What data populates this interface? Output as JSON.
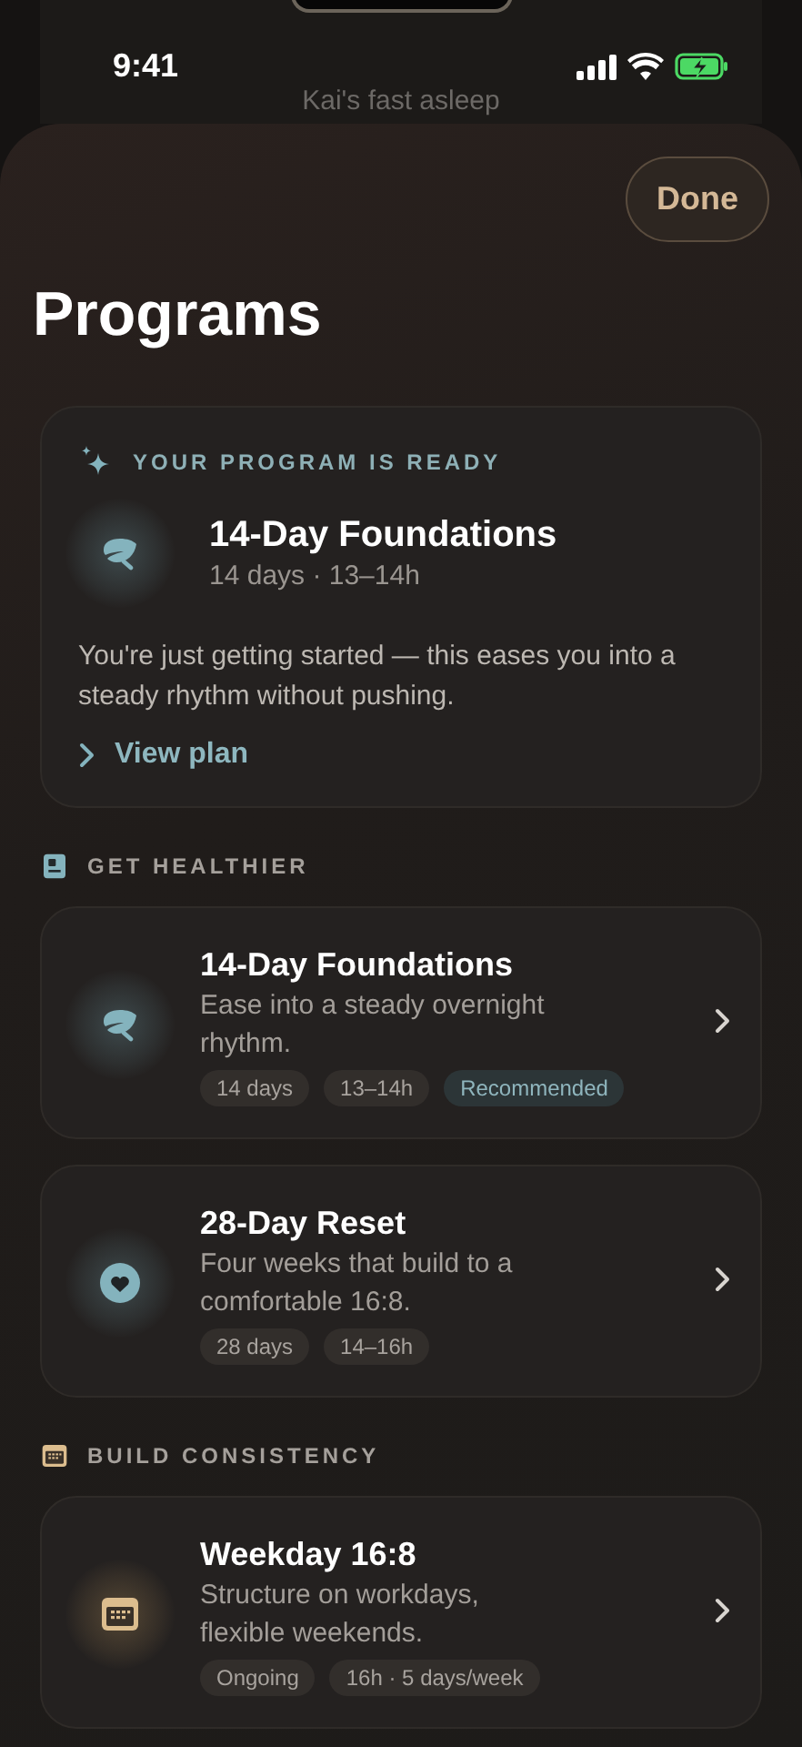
{
  "status_bar": {
    "time": "9:41",
    "subtitle": "Kai's fast asleep",
    "charging": true
  },
  "sheet": {
    "done_button": "Done",
    "title": "Programs"
  },
  "featured": {
    "label": "YOUR PROGRAM IS READY",
    "kind": "leaf",
    "title": "14-Day Foundations",
    "meta": "14 days · 13–14h",
    "description": "You're just getting started — this eases you into a steady rhythm without pushing.",
    "link": "View plan"
  },
  "sections": [
    {
      "title": "GET HEALTHIER",
      "kind": "clipboard",
      "programs": [
        {
          "kind": "leaf",
          "title": "14-Day Foundations",
          "description": "Ease into a steady overnight rhythm.",
          "tags": [
            {
              "text": "14 days",
              "kind": "plain"
            },
            {
              "text": "13–14h",
              "kind": "plain"
            },
            {
              "text": "Recommended",
              "kind": "recommended"
            }
          ]
        },
        {
          "kind": "heart",
          "title": "28-Day Reset",
          "description": "Four weeks that build to a comfortable 16:8.",
          "tags": [
            {
              "text": "28 days",
              "kind": "plain"
            },
            {
              "text": "14–16h",
              "kind": "plain"
            }
          ]
        }
      ]
    },
    {
      "title": "BUILD CONSISTENCY",
      "kind": "calendar",
      "programs": [
        {
          "kind": "calendar",
          "title": "Weekday 16:8",
          "description": "Structure on workdays, flexible weekends.",
          "tags": [
            {
              "text": "Ongoing",
              "kind": "plain"
            },
            {
              "text": "16h · 5 days/week",
              "kind": "plain"
            }
          ]
        }
      ]
    }
  ]
}
